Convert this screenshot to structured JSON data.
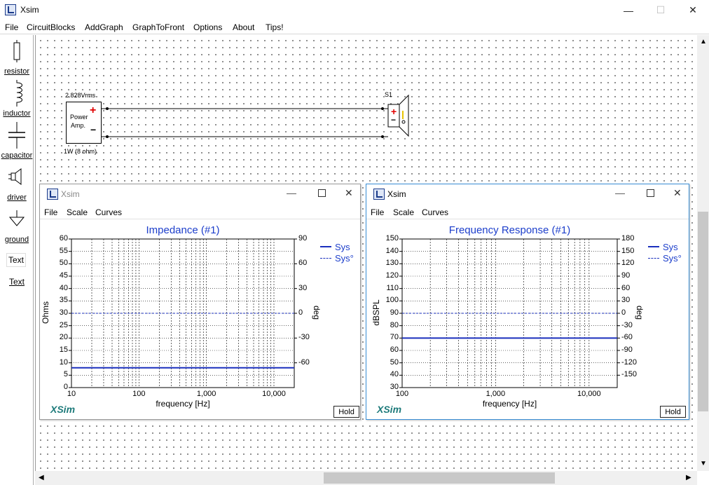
{
  "app": {
    "title": "Xsim"
  },
  "window_controls": {
    "minimize": "—",
    "maximize": "☐",
    "close": "✕"
  },
  "menu": [
    "File",
    "CircuitBlocks",
    "AddGraph",
    "GraphToFront",
    "Options",
    "About",
    "Tips!"
  ],
  "toolbox": [
    {
      "label": "resistor",
      "icon": "resistor-icon"
    },
    {
      "label": "inductor",
      "icon": "inductor-icon"
    },
    {
      "label": "capacitor",
      "icon": "capacitor-icon"
    },
    {
      "label": "driver",
      "icon": "driver-icon"
    },
    {
      "label": "ground",
      "icon": "ground-icon"
    },
    {
      "label": "Text",
      "icon": "text-icon",
      "box_text": "Text"
    }
  ],
  "circuit": {
    "amp": {
      "voltage": "2.828Vrms",
      "name_line1": "Power",
      "name_line2": "Amp.",
      "power": "1W (8 ohm)",
      "plus": "+",
      "minus": "−"
    },
    "speaker": {
      "label": "S1",
      "plus": "+",
      "minus": "−"
    }
  },
  "graphs": [
    {
      "window_title": "Xsim",
      "menu": [
        "File",
        "Scale",
        "Curves"
      ],
      "title": "Impedance (#1)",
      "ylabel": "Ohms",
      "y2label": "deg",
      "xlabel": "frequency [Hz]",
      "xticks": [
        "10",
        "100",
        "1,000",
        "10,000"
      ],
      "yticks": [
        "60",
        "55",
        "50",
        "45",
        "40",
        "35",
        "30",
        "25",
        "20",
        "15",
        "10",
        "5",
        "0"
      ],
      "y2ticks": [
        "90",
        "60",
        "30",
        "0",
        "-30",
        "-60"
      ],
      "legend": [
        "Sys",
        "Sys°"
      ],
      "logo": "XSim",
      "hold": "Hold"
    },
    {
      "window_title": "Xsim",
      "menu": [
        "File",
        "Scale",
        "Curves"
      ],
      "title": "Frequency Response (#1)",
      "ylabel": "dBSPL",
      "y2label": "deg",
      "xlabel": "frequency [Hz]",
      "xticks": [
        "100",
        "1,000",
        "10,000"
      ],
      "yticks": [
        "150",
        "140",
        "130",
        "120",
        "110",
        "100",
        "90",
        "80",
        "70",
        "60",
        "50",
        "40",
        "30"
      ],
      "y2ticks": [
        "180",
        "150",
        "120",
        "90",
        "60",
        "30",
        "0",
        "-30",
        "-60",
        "-90",
        "-120",
        "-150"
      ],
      "legend": [
        "Sys",
        "Sys°"
      ],
      "logo": "XSim",
      "hold": "Hold"
    }
  ],
  "chart_data": [
    {
      "type": "line",
      "title": "Impedance (#1)",
      "xlabel": "frequency [Hz]",
      "ylabel": "Ohms",
      "y2label": "deg",
      "xscale": "log",
      "xlim": [
        10,
        20000
      ],
      "ylim": [
        0,
        60
      ],
      "y2lim": [
        -90,
        90
      ],
      "grid": true,
      "legend_position": "top-right",
      "series": [
        {
          "name": "Sys",
          "axis": "left",
          "style": "solid",
          "x": [
            10,
            20000
          ],
          "y": [
            8,
            8
          ]
        },
        {
          "name": "Sys°",
          "axis": "right",
          "style": "dashed",
          "x": [
            10,
            20000
          ],
          "y": [
            0,
            0
          ]
        }
      ]
    },
    {
      "type": "line",
      "title": "Frequency Response (#1)",
      "xlabel": "frequency [Hz]",
      "ylabel": "dBSPL",
      "y2label": "deg",
      "xscale": "log",
      "xlim": [
        100,
        20000
      ],
      "ylim": [
        30,
        150
      ],
      "y2lim": [
        -180,
        180
      ],
      "grid": true,
      "legend_position": "top-right",
      "series": [
        {
          "name": "Sys",
          "axis": "left",
          "style": "solid",
          "x": [
            100,
            20000
          ],
          "y": [
            70,
            70
          ]
        },
        {
          "name": "Sys°",
          "axis": "right",
          "style": "dashed",
          "x": [
            100,
            20000
          ],
          "y": [
            0,
            0
          ]
        }
      ]
    }
  ],
  "colors": {
    "curve": "#1a2fbd",
    "title": "#1c3ecb",
    "logo": "#1d7a7a",
    "amp_plus": "#e00000",
    "speaker_accent": "#e8c400"
  }
}
